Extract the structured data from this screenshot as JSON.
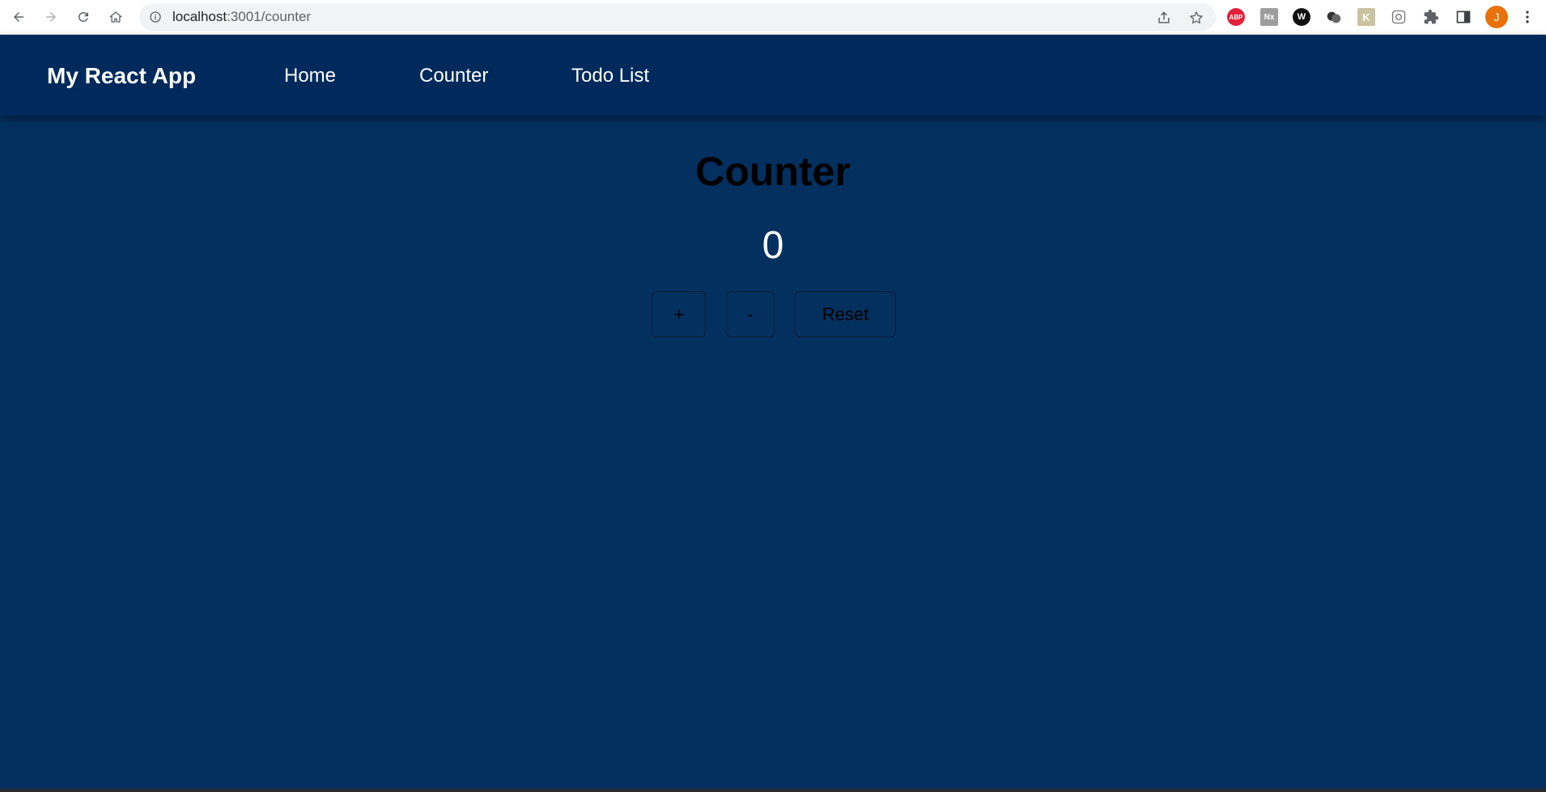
{
  "browser": {
    "url_host": "localhost",
    "url_path": ":3001/counter",
    "profile_initial": "J",
    "extensions": [
      "ABP",
      "Nx",
      "W",
      "K"
    ]
  },
  "app": {
    "brand": "My React App",
    "nav": [
      "Home",
      "Counter",
      "Todo List"
    ]
  },
  "counter": {
    "title": "Counter",
    "value": "0",
    "increment_label": "+",
    "decrement_label": "-",
    "reset_label": "Reset"
  }
}
